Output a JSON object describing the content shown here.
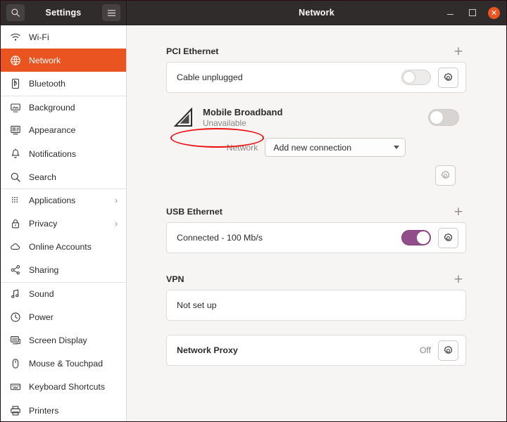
{
  "window": {
    "sidebar_title": "Settings",
    "content_title": "Network",
    "search_icon": "search-icon",
    "menu_icon": "hamburger-menu-icon",
    "minimize_label": "–",
    "maximize_label": "□",
    "close_label": "✕",
    "accent_color": "#e95420"
  },
  "sidebar": {
    "items": [
      {
        "label": "Wi-Fi",
        "icon": "wifi-icon",
        "active": false,
        "chevron": false,
        "separator": false
      },
      {
        "label": "Network",
        "icon": "globe-icon",
        "active": true,
        "chevron": false,
        "separator": false
      },
      {
        "label": "Bluetooth",
        "icon": "bluetooth-icon",
        "active": false,
        "chevron": false,
        "separator": false
      },
      {
        "label": "Background",
        "icon": "monitor-icon",
        "active": false,
        "chevron": false,
        "separator": true
      },
      {
        "label": "Appearance",
        "icon": "appearance-icon",
        "active": false,
        "chevron": false,
        "separator": false
      },
      {
        "label": "Notifications",
        "icon": "bell-icon",
        "active": false,
        "chevron": false,
        "separator": false
      },
      {
        "label": "Search",
        "icon": "search-icon",
        "active": false,
        "chevron": false,
        "separator": false
      },
      {
        "label": "Applications",
        "icon": "grid-dots-icon",
        "active": false,
        "chevron": true,
        "separator": true
      },
      {
        "label": "Privacy",
        "icon": "lock-icon",
        "active": false,
        "chevron": true,
        "separator": false
      },
      {
        "label": "Online Accounts",
        "icon": "cloud-icon",
        "active": false,
        "chevron": false,
        "separator": false
      },
      {
        "label": "Sharing",
        "icon": "share-icon",
        "active": false,
        "chevron": false,
        "separator": false
      },
      {
        "label": "Sound",
        "icon": "music-note-icon",
        "active": false,
        "chevron": false,
        "separator": true
      },
      {
        "label": "Power",
        "icon": "power-icon",
        "active": false,
        "chevron": false,
        "separator": false
      },
      {
        "label": "Screen Display",
        "icon": "screen-display-icon",
        "active": false,
        "chevron": false,
        "separator": false
      },
      {
        "label": "Mouse & Touchpad",
        "icon": "mouse-icon",
        "active": false,
        "chevron": false,
        "separator": false
      },
      {
        "label": "Keyboard Shortcuts",
        "icon": "keyboard-icon",
        "active": false,
        "chevron": false,
        "separator": false
      },
      {
        "label": "Printers",
        "icon": "printer-icon",
        "active": false,
        "chevron": false,
        "separator": false
      }
    ],
    "chevron_glyph": "›"
  },
  "network": {
    "pci_ethernet": {
      "title": "PCI Ethernet",
      "add_label": "+",
      "row_status": "Cable unplugged",
      "toggle_state": "off",
      "settings_icon": "gear-icon"
    },
    "mobile_broadband": {
      "title": "Mobile Broadband",
      "subtitle": "Unavailable",
      "icon": "signal-triangle-icon",
      "toggle_state": "off",
      "network_label": "Network",
      "connection_value": "Add new connection",
      "settings_icon": "gear-icon"
    },
    "usb_ethernet": {
      "title": "USB Ethernet",
      "add_label": "+",
      "row_status": "Connected - 100 Mb/s",
      "toggle_state": "on",
      "toggle_color": "#924d8b",
      "settings_icon": "gear-icon",
      "highlight_color": "#ee1111"
    },
    "vpn": {
      "title": "VPN",
      "add_label": "+",
      "row_status": "Not set up"
    },
    "network_proxy": {
      "title": "Network Proxy",
      "value": "Off",
      "settings_icon": "gear-icon"
    }
  }
}
